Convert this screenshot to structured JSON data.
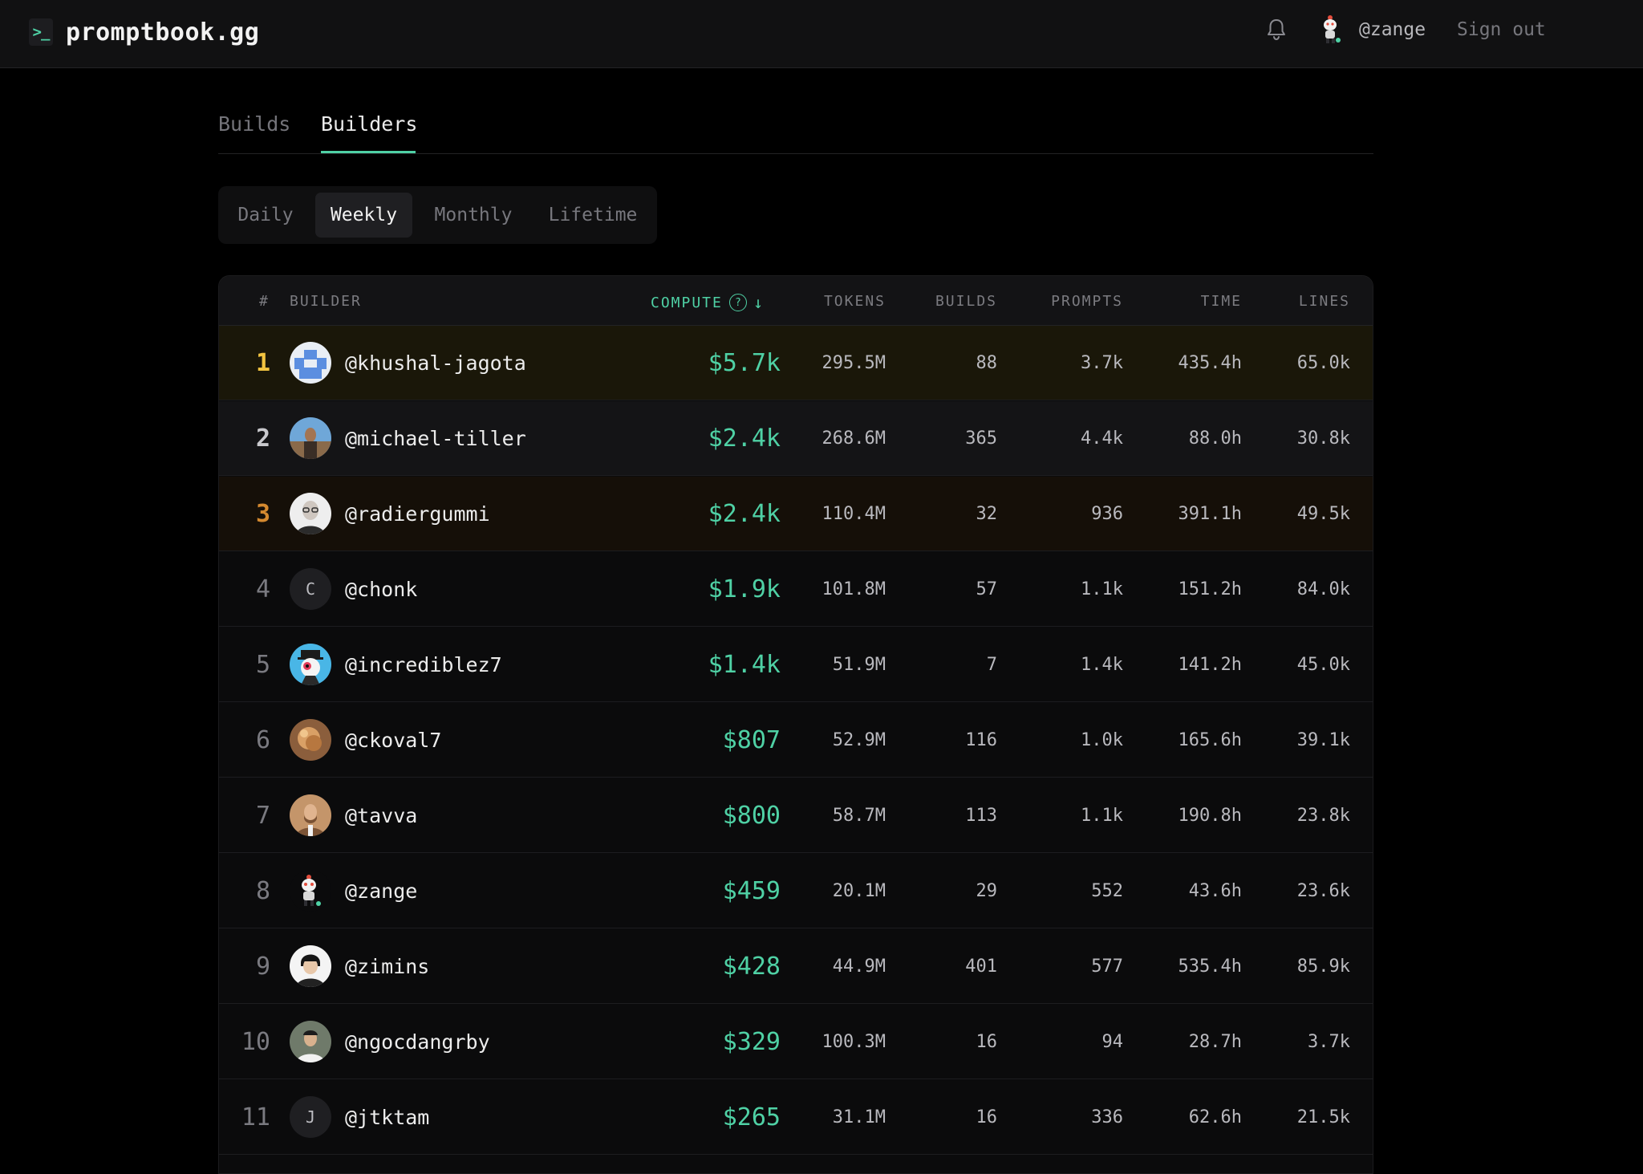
{
  "header": {
    "logo_mark": ">_",
    "logo_text": "promptbook.gg",
    "username": "@zange",
    "sign_out": "Sign out"
  },
  "tabs": {
    "builds": "Builds",
    "builders": "Builders",
    "active": "Builders"
  },
  "period": {
    "daily": "Daily",
    "weekly": "Weekly",
    "monthly": "Monthly",
    "lifetime": "Lifetime",
    "active": "Weekly"
  },
  "columns": {
    "rank": "#",
    "builder": "BUILDER",
    "compute": "COMPUTE",
    "help": "?",
    "sort": "↓",
    "tokens": "TOKENS",
    "builds": "BUILDS",
    "prompts": "PROMPTS",
    "time": "TIME",
    "lines": "LINES"
  },
  "colors": {
    "accent": "#4fd1a5",
    "gold": "#f2c440",
    "silver": "#c9c9cd",
    "bronze": "#d4892f",
    "background": "#000000"
  },
  "rows": [
    {
      "rank": "1",
      "name": "@khushal-jagota",
      "avatar": "pixel-avatar",
      "compute": "$5.7k",
      "tokens": "295.5M",
      "builds": "88",
      "prompts": "3.7k",
      "time": "435.4h",
      "lines": "65.0k"
    },
    {
      "rank": "2",
      "name": "@michael-tiller",
      "avatar": "photo-avatar",
      "compute": "$2.4k",
      "tokens": "268.6M",
      "builds": "365",
      "prompts": "4.4k",
      "time": "88.0h",
      "lines": "30.8k"
    },
    {
      "rank": "3",
      "name": "@radiergummi",
      "avatar": "photo-avatar",
      "compute": "$2.4k",
      "tokens": "110.4M",
      "builds": "32",
      "prompts": "936",
      "time": "391.1h",
      "lines": "49.5k"
    },
    {
      "rank": "4",
      "name": "@chonk",
      "avatar_letter": "C",
      "compute": "$1.9k",
      "tokens": "101.8M",
      "builds": "57",
      "prompts": "1.1k",
      "time": "151.2h",
      "lines": "84.0k"
    },
    {
      "rank": "5",
      "name": "@incrediblez7",
      "avatar": "cartoon-avatar",
      "compute": "$1.4k",
      "tokens": "51.9M",
      "builds": "7",
      "prompts": "1.4k",
      "time": "141.2h",
      "lines": "45.0k"
    },
    {
      "rank": "6",
      "name": "@ckoval7",
      "avatar": "photo-avatar",
      "compute": "$807",
      "tokens": "52.9M",
      "builds": "116",
      "prompts": "1.0k",
      "time": "165.6h",
      "lines": "39.1k"
    },
    {
      "rank": "7",
      "name": "@tavva",
      "avatar": "photo-avatar",
      "compute": "$800",
      "tokens": "58.7M",
      "builds": "113",
      "prompts": "1.1k",
      "time": "190.8h",
      "lines": "23.8k"
    },
    {
      "rank": "8",
      "name": "@zange",
      "avatar": "robot-avatar",
      "compute": "$459",
      "tokens": "20.1M",
      "builds": "29",
      "prompts": "552",
      "time": "43.6h",
      "lines": "23.6k"
    },
    {
      "rank": "9",
      "name": "@zimins",
      "avatar": "photo-avatar",
      "compute": "$428",
      "tokens": "44.9M",
      "builds": "401",
      "prompts": "577",
      "time": "535.4h",
      "lines": "85.9k"
    },
    {
      "rank": "10",
      "name": "@ngocdangrby",
      "avatar": "photo-avatar",
      "compute": "$329",
      "tokens": "100.3M",
      "builds": "16",
      "prompts": "94",
      "time": "28.7h",
      "lines": "3.7k"
    },
    {
      "rank": "11",
      "name": "@jtktam",
      "avatar_letter": "J",
      "compute": "$265",
      "tokens": "31.1M",
      "builds": "16",
      "prompts": "336",
      "time": "62.6h",
      "lines": "21.5k"
    }
  ]
}
